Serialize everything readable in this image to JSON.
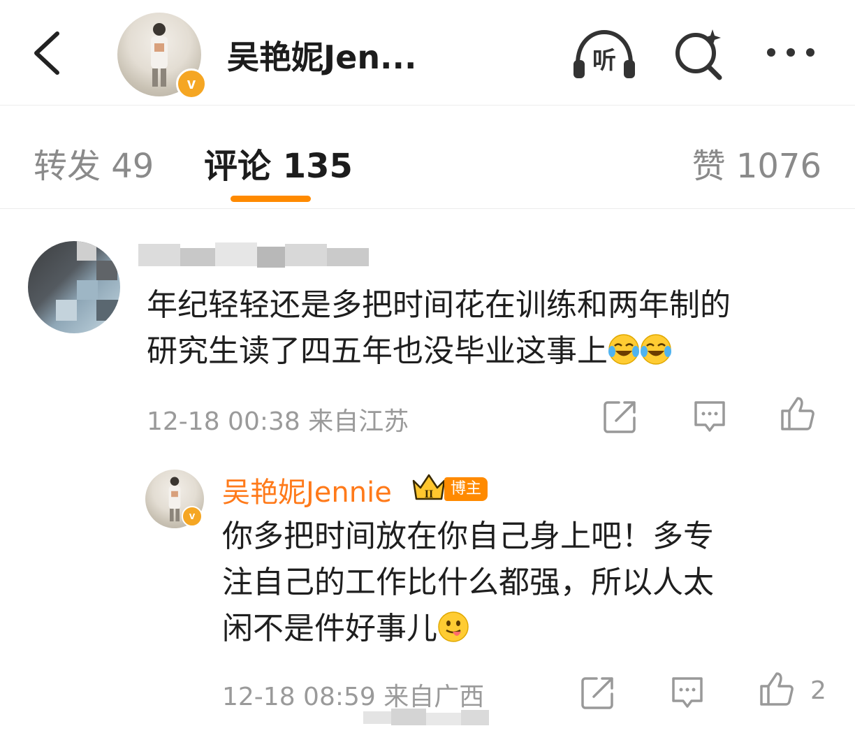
{
  "header": {
    "title": "吴艳妮Jen...",
    "back_icon": "chevron-left-icon",
    "listen_label": "听",
    "search_icon": "search-sparkle-icon",
    "more_icon": "more-dots-icon",
    "verified_mark": "v"
  },
  "tabs": {
    "repost": "转发 49",
    "comment": "评论 135",
    "like": "赞 1076",
    "active_color": "#ff8a00"
  },
  "comment": {
    "lines": [
      "年纪轻轻还是多把时间花在训练和两年制的",
      "研究生读了四五年也没毕业这事上"
    ],
    "emojis": [
      "laugh-cry-emoji",
      "laugh-cry-emoji"
    ],
    "time": "12-18 00:38",
    "location": "来自江苏"
  },
  "reply": {
    "author": "吴艳妮Jennie",
    "author_color": "#ff7a1a",
    "crown_level": "II",
    "badge": "博主",
    "verified_mark": "v",
    "lines": [
      "你多把时间放在你自己身上吧！多专",
      "注自己的工作比什么都强，所以人太",
      "闲不是件好事儿"
    ],
    "emoji": "tongue-out-emoji",
    "time": "12-18 08:59",
    "location": "来自广西",
    "likes": "2"
  }
}
